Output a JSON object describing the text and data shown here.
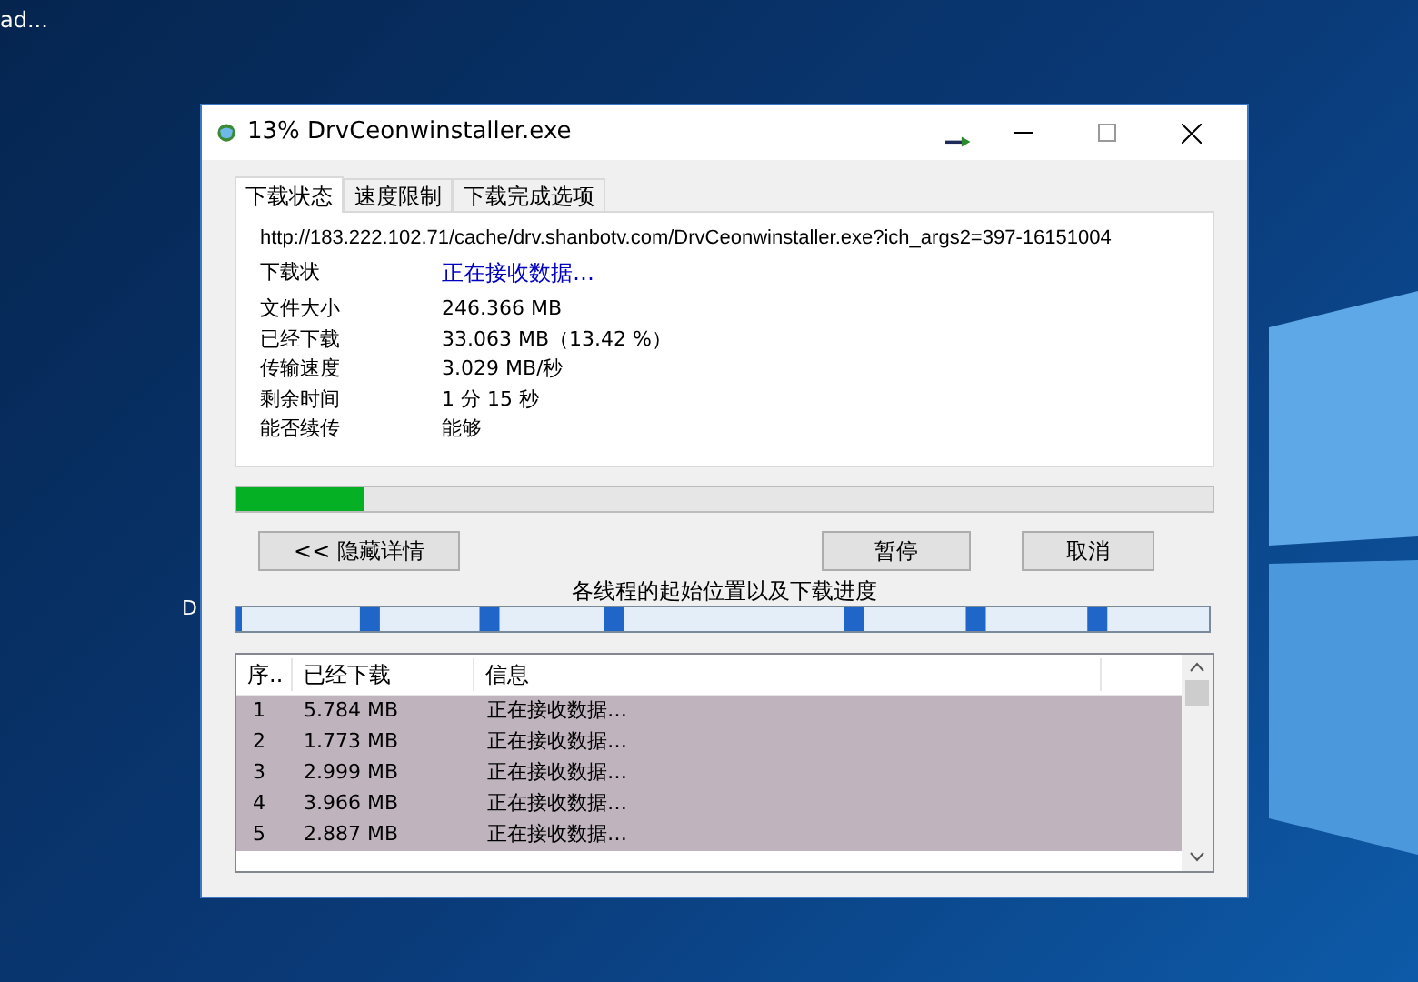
{
  "desktop": {
    "icon_labels": [
      "ad...",
      "D"
    ]
  },
  "window": {
    "title": "13% DrvCeonwinstaller.exe"
  },
  "tabs": [
    {
      "label": "下载状态",
      "selected": true
    },
    {
      "label": "速度限制",
      "selected": false
    },
    {
      "label": "下载完成选项",
      "selected": false
    }
  ],
  "status": {
    "url": "http://183.222.102.71/cache/drv.shanbotv.com/DrvCeonwinstaller.exe?ich_args2=397-16151004",
    "rows": [
      {
        "label": "下载状",
        "value": "正在接收数据…",
        "kind": "link"
      },
      {
        "label": "文件大小",
        "value": "246.366  MB",
        "kind": "plain"
      },
      {
        "label": "已经下载",
        "value": "33.063  MB（13.42 %）",
        "kind": "plain"
      },
      {
        "label": "传输速度",
        "value": "3.029  MB/秒",
        "kind": "plain"
      },
      {
        "label": "剩余时间",
        "value": "1 分 15 秒",
        "kind": "plain"
      },
      {
        "label": "能否续传",
        "value": "能够",
        "kind": "plain"
      }
    ]
  },
  "progress": {
    "level": 0.13
  },
  "buttons": [
    "<< 隐藏详情",
    "暂停",
    "取消"
  ],
  "threads_label": "各线程的起始位置以及下载进度",
  "table": {
    "columns": [
      "序..",
      "已经下载",
      "信息"
    ],
    "rows": [
      {
        "cells": [
          "1",
          "5.784  MB",
          "正在接收数据…"
        ],
        "selected": true
      },
      {
        "cells": [
          "2",
          "1.773  MB",
          "正在接收数据…"
        ],
        "selected": true
      },
      {
        "cells": [
          "3",
          "2.999  MB",
          "正在接收数据…"
        ],
        "selected": true
      },
      {
        "cells": [
          "4",
          "3.966  MB",
          "正在接收数据…"
        ],
        "selected": true
      },
      {
        "cells": [
          "5",
          "2.887  MB",
          "正在接收数据…"
        ],
        "selected": true
      }
    ]
  }
}
